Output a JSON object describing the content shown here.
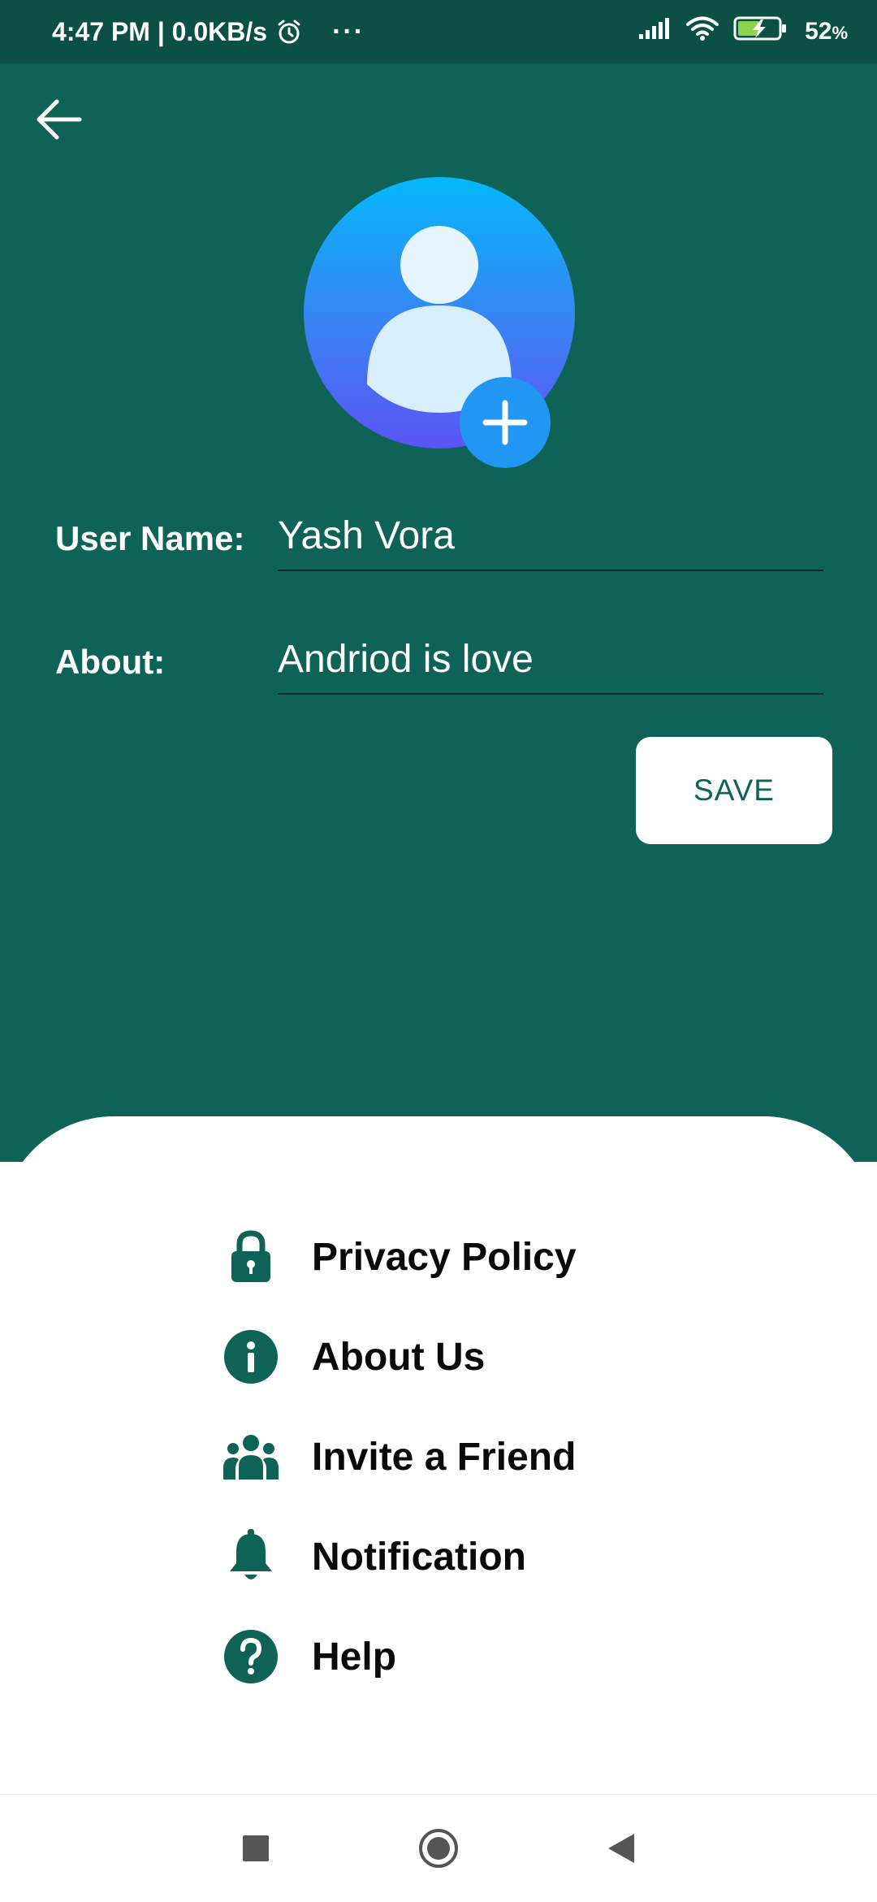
{
  "status_bar": {
    "time_speed": "4:47 PM | 0.0KB/s",
    "dots": "···",
    "battery_percent": "52",
    "battery_unit": "%"
  },
  "profile": {
    "username_label": "User Name:",
    "username_value": "Yash Vora",
    "about_label": "About:",
    "about_value": "Andriod is love",
    "save_label": "SAVE"
  },
  "menu": {
    "items": [
      {
        "label": "Privacy Policy",
        "icon": "lock-icon"
      },
      {
        "label": "About Us",
        "icon": "info-icon"
      },
      {
        "label": "Invite a Friend",
        "icon": "group-icon"
      },
      {
        "label": "Notification",
        "icon": "bell-icon"
      },
      {
        "label": "Help",
        "icon": "help-icon"
      }
    ]
  },
  "colors": {
    "primary": "#0f6356",
    "status_bar": "#0b4f45",
    "accent_blue": "#2196f3",
    "sheet": "#ffffff"
  }
}
